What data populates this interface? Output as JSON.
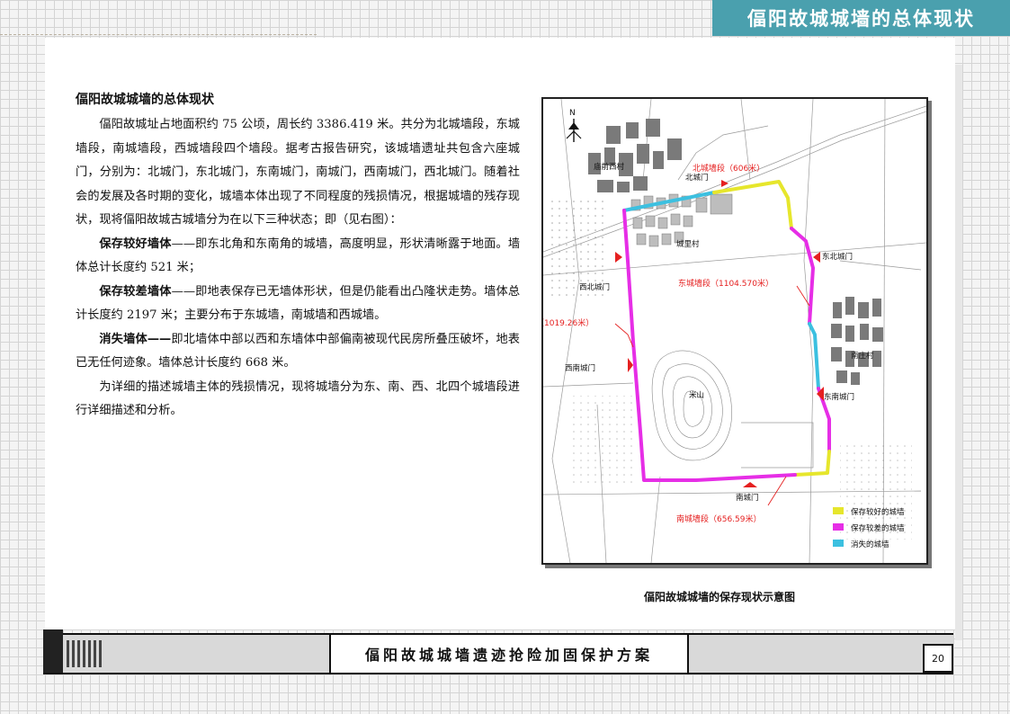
{
  "header": {
    "title": "偪阳故城城墙的总体现状"
  },
  "section": {
    "title": "偪阳故城城墙的总体现状",
    "p1": "偪阳故城址占地面积约 75 公顷，周长约 3386.419 米。共分为北城墙段，东城墙段，南城墙段，西城墙段四个墙段。据考古报告研究，该城墙遗址共包含六座城门，分别为：北城门，东北城门，东南城门，南城门，西南城门，西北城门。随着社会的发展及各时期的变化，城墙本体出现了不同程度的残损情况，根据城墙的残存现状，现将偪阳故城古城墙分为在以下三种状态；即（见右图）：",
    "good_label": "保存较好墙体",
    "good_text": "——即东北角和东南角的城墙，高度明显，形状清晰露于地面。墙体总计长度约 521 米；",
    "poor_label": "保存较差墙体",
    "poor_text": "——即地表保存已无墙体形状，但是仍能看出凸隆状走势。墙体总计长度约 2197 米；主要分布于东城墙，南城墙和西城墙。",
    "lost_label": "消失墙体——",
    "lost_text": "即北墙体中部以西和东墙体中部偏南被现代民房所叠压破坏，地表已无任何迹象。墙体总计长度约 668 米。",
    "p_last": "为详细的描述城墙主体的残损情况，现将城墙分为东、南、西、北四个城墙段进行详细描述和分析。"
  },
  "map": {
    "north_mark": "N",
    "segments": {
      "north": "北城墙段（606米）",
      "east": "东城墙段（1104.570米）",
      "west": "西城墙段（1019.26米）",
      "south": "南城墙段（656.59米）"
    },
    "gates": {
      "north": "北城门",
      "northeast": "东北城门",
      "northwest": "西北城门",
      "southwest": "西南城门",
      "southeast": "东南城门",
      "south": "南城门"
    },
    "places": {
      "village_nw": "庙前西村",
      "village_in": "城里村",
      "village_e": "南庄村",
      "hill": "米山"
    },
    "legend": [
      {
        "label": "保存较好的城墙",
        "color": "#e6e62c"
      },
      {
        "label": "保存较差的城墙",
        "color": "#e62ee6"
      },
      {
        "label": "消失的城墙",
        "color": "#3cc0e0"
      }
    ],
    "caption": "偪阳故城城墙的保存现状示意图"
  },
  "footer": {
    "title": "偪阳故城城墙遗迹抢险加固保护方案",
    "page": "20"
  }
}
